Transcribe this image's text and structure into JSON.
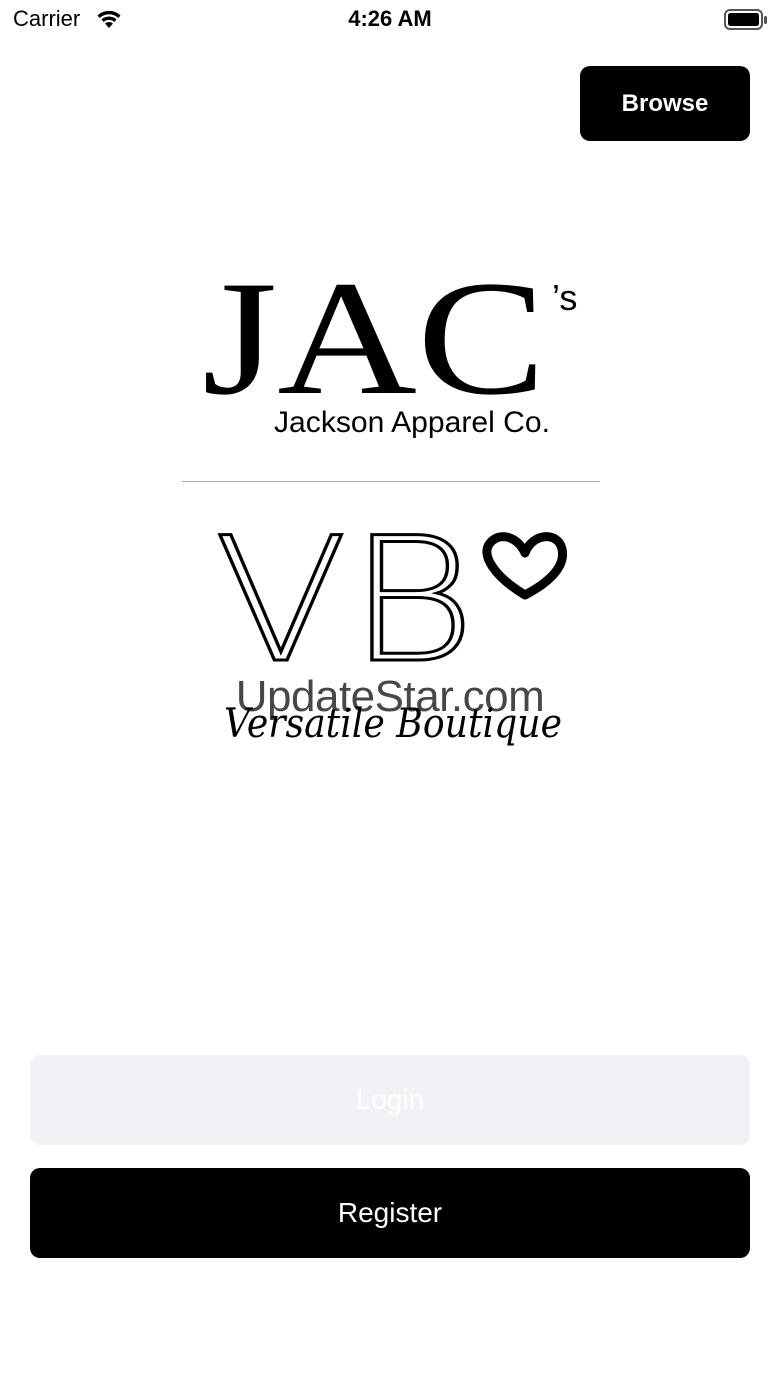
{
  "status_bar": {
    "carrier": "Carrier",
    "time": "4:26 AM",
    "wifi_icon": "wifi-icon",
    "battery_icon": "battery-icon"
  },
  "header": {
    "browse_label": "Browse"
  },
  "logos": {
    "jacs": {
      "main": "JAC",
      "suffix": "’s",
      "tagline": "Jackson Apparel Co."
    },
    "vb": {
      "main": "VB",
      "script": "Versatile Boutique",
      "heart_icon": "heart-icon"
    }
  },
  "watermark": "UpdateStar.com",
  "actions": {
    "login_label": "Login",
    "register_label": "Register"
  },
  "colors": {
    "primary": "#000000",
    "disabled_bg": "#f1f1f6",
    "divider": "#a8a8a8"
  }
}
